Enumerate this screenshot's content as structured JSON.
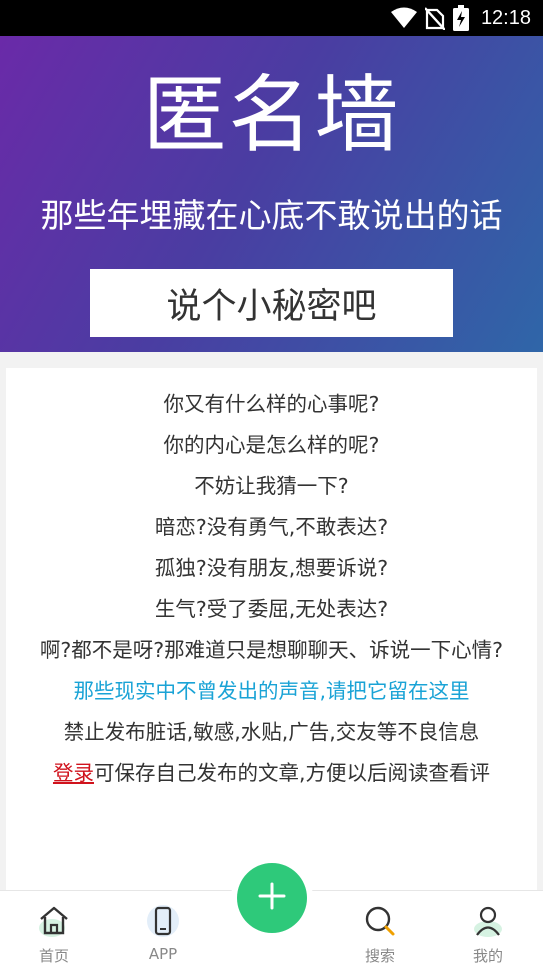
{
  "status_bar": {
    "time": "12:18",
    "icons": [
      "wifi-icon",
      "no-sim-icon",
      "battery-charging-icon"
    ]
  },
  "hero": {
    "title": "匿名墙",
    "subtitle": "那些年埋藏在心底不敢说出的话",
    "cta_label": "说个小秘密吧"
  },
  "content": {
    "lines": [
      "你又有什么样的心事呢?",
      "你的内心是怎么样的呢?",
      "不妨让我猜一下?",
      "暗恋?没有勇气,不敢表达?",
      "孤独?没有朋友,想要诉说?",
      "生气?受了委屈,无处表达?",
      "啊?都不是呀?那难道只是想聊聊天、诉说一下心情?"
    ],
    "highlight": "那些现实中不曾发出的声音,请把它留在这里",
    "rules": "禁止发布脏话,敏感,水贴,广告,交友等不良信息",
    "login_link": "登录",
    "login_text": "可保存自己发布的文章,方便以后阅读查看评"
  },
  "bottom_nav": {
    "items": [
      {
        "label": "首页",
        "icon": "home-icon"
      },
      {
        "label": "APP",
        "icon": "phone-icon"
      },
      {
        "label": "",
        "icon": "plus-icon"
      },
      {
        "label": "搜索",
        "icon": "search-icon"
      },
      {
        "label": "我的",
        "icon": "user-icon"
      }
    ]
  },
  "colors": {
    "hero_gradient_start": "#6a2aa8",
    "hero_gradient_end": "#2f66a8",
    "highlight": "#1aa3d6",
    "login_link": "#d0121c",
    "fab": "#2ec97a"
  }
}
